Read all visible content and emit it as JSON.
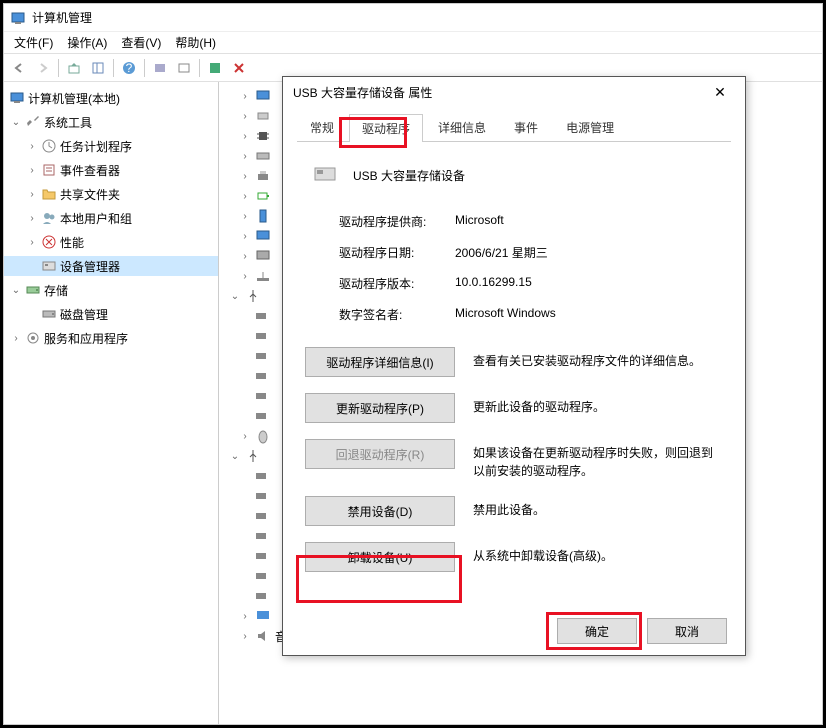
{
  "window": {
    "title": "计算机管理"
  },
  "menu": {
    "file": "文件(F)",
    "action": "操作(A)",
    "view": "查看(V)",
    "help": "帮助(H)"
  },
  "tree": {
    "root": "计算机管理(本地)",
    "system_tools": "系统工具",
    "task_scheduler": "任务计划程序",
    "event_viewer": "事件查看器",
    "shared_folders": "共享文件夹",
    "local_users": "本地用户和组",
    "performance": "性能",
    "device_manager": "设备管理器",
    "storage": "存储",
    "disk_mgmt": "磁盘管理",
    "services_apps": "服务和应用程序"
  },
  "center": {
    "audio_io": "音频输入和输出"
  },
  "dialog": {
    "title": "USB 大容量存储设备 属性",
    "tabs": {
      "general": "常规",
      "driver": "驱动程序",
      "details": "详细信息",
      "events": "事件",
      "power": "电源管理"
    },
    "device_name": "USB 大容量存储设备",
    "props": {
      "provider_label": "驱动程序提供商:",
      "provider_value": "Microsoft",
      "date_label": "驱动程序日期:",
      "date_value": "2006/6/21 星期三",
      "version_label": "驱动程序版本:",
      "version_value": "10.0.16299.15",
      "signer_label": "数字签名者:",
      "signer_value": "Microsoft Windows"
    },
    "actions": {
      "details_btn": "驱动程序详细信息(I)",
      "details_desc": "查看有关已安装驱动程序文件的详细信息。",
      "update_btn": "更新驱动程序(P)",
      "update_desc": "更新此设备的驱动程序。",
      "rollback_btn": "回退驱动程序(R)",
      "rollback_desc": "如果该设备在更新驱动程序时失败，则回退到以前安装的驱动程序。",
      "disable_btn": "禁用设备(D)",
      "disable_desc": "禁用此设备。",
      "uninstall_btn": "卸载设备(U)",
      "uninstall_desc": "从系统中卸载设备(高级)。"
    },
    "ok": "确定",
    "cancel": "取消"
  }
}
